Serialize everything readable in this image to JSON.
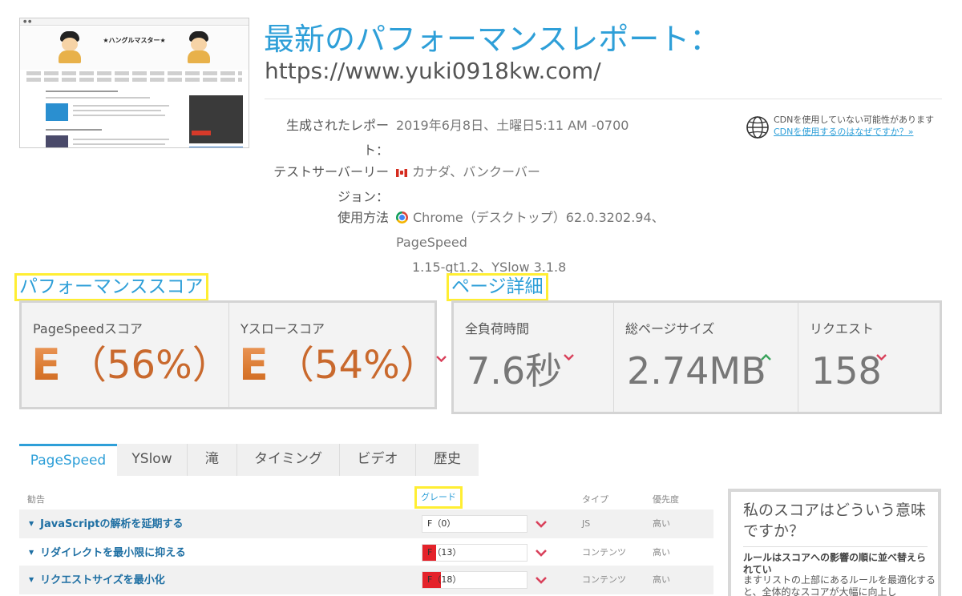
{
  "thumbnail": {
    "site_title": "★ハングルマスター★"
  },
  "header": {
    "title": "最新のパフォーマンスレポート：",
    "url": "https://www.yuki0918kw.com/"
  },
  "meta": {
    "generated_label_1": "生成されたレポー",
    "generated_label_2": "ト：",
    "generated_value": "2019年6月8日、土曜日5:11 AM -0700",
    "server_label_1": "テストサーバーリー",
    "server_label_2": "ジョン：",
    "server_value": "カナダ、バンクーバー",
    "method_label": "使用方法",
    "method_value_1": "Chrome（デスクトップ）62.0.3202.94、PageSpeed",
    "method_value_2": "1.15-gt1.2、YSlow 3.1.8"
  },
  "cdn": {
    "notice": "CDNを使用していない可能性があります",
    "link": "CDNを使用するのはなぜですか？»"
  },
  "performance": {
    "heading": "パフォーマンススコア",
    "pagespeed_label": "PageSpeedスコア",
    "pagespeed_grade": "E",
    "pagespeed_pct": "（56%）",
    "yslow_label": "Yスロースコア",
    "yslow_grade": "E",
    "yslow_pct": "（54%）"
  },
  "details": {
    "heading": "ページ詳細",
    "load_label": "全負荷時間",
    "load_value": "7.6秒",
    "size_label": "総ページサイズ",
    "size_value": "2.74MB",
    "requests_label": "リクエスト",
    "requests_value": "158"
  },
  "colors": {
    "accent": "#2e9fd8",
    "highlight": "#ffee33",
    "grade_orange": "#c9692d",
    "chevron_red": "#d9415b",
    "chevron_green": "#3aa35b",
    "fail_red": "#e4222a"
  },
  "tabs": [
    "PageSpeed",
    "YSlow",
    "滝",
    "タイミング",
    "ビデオ",
    "歴史"
  ],
  "table": {
    "headers": {
      "advice": "勧告",
      "grade": "グレード",
      "type": "タイプ",
      "priority": "優先度"
    },
    "rows": [
      {
        "rule": "JavaScriptの解析を延期する",
        "grade": "F（0）",
        "fill": 0,
        "type": "JS",
        "priority": "高い"
      },
      {
        "rule": "リダイレクトを最小限に抑える",
        "grade": "F（13）",
        "fill": 0.13,
        "type": "コンテンツ",
        "priority": "高い"
      },
      {
        "rule": "リクエストサイズを最小化",
        "grade": "F（18）",
        "fill": 0.18,
        "type": "コンテンツ",
        "priority": "高い"
      }
    ]
  },
  "side": {
    "title": "私のスコアはどういう意味ですか？",
    "bold": "ルールはスコアへの影響の順に並べ替えられてい",
    "text": "ますリストの上部にあるルールを最適化すると、全体的なスコアが大幅に向上し"
  }
}
